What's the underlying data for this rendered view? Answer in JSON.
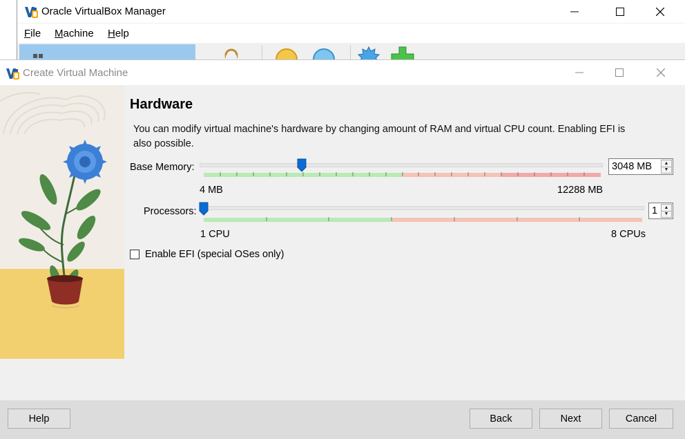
{
  "manager": {
    "title": "Oracle VirtualBox Manager",
    "menu": [
      {
        "label": "File",
        "mnemonic": "F",
        "rest": "ile"
      },
      {
        "label": "Machine",
        "mnemonic": "M",
        "rest": "achine"
      },
      {
        "label": "Help",
        "mnemonic": "H",
        "rest": "elp"
      }
    ]
  },
  "dialog": {
    "title": "Create Virtual Machine",
    "page_title": "Hardware",
    "description": "You can modify virtual machine's hardware by changing amount of RAM and virtual CPU count. Enabling EFI is also possible.",
    "memory": {
      "label": "Base Memory:",
      "value": "3048 MB",
      "value_mb": 3048,
      "min_label": "4 MB",
      "max_label": "12288 MB",
      "min": 4,
      "max": 12288,
      "recommended_limit_mb": 6144,
      "warning_limit_mb": 9216
    },
    "processors": {
      "label": "Processors:",
      "value": "1",
      "value_num": 1,
      "min_label": "1 CPU",
      "max_label": "8 CPUs",
      "min": 1,
      "max": 8,
      "recommended_limit": 4
    },
    "efi": {
      "label": "Enable EFI (special OSes only)",
      "checked": false
    },
    "buttons": {
      "help": "Help",
      "back": "Back",
      "next": "Next",
      "cancel": "Cancel"
    }
  },
  "colors": {
    "slider_green": "#b9eab5",
    "slider_red": "#f4c4b6",
    "slider_deep_red": "#f0aaa8",
    "thumb_blue": "#0a6bd3",
    "selection_blue": "#99c9ef"
  },
  "icons": {
    "app_logo": "virtualbox-logo-icon",
    "minimize": "minimize-icon",
    "maximize": "maximize-icon",
    "close": "close-icon"
  }
}
